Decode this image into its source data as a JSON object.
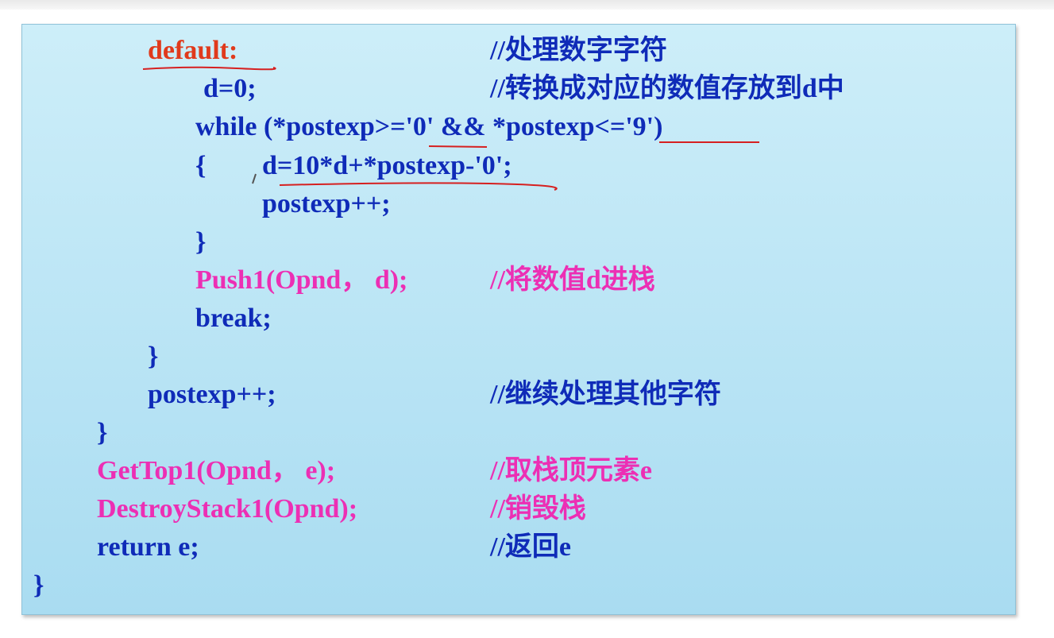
{
  "lines": {
    "default_kw": "default:",
    "c_default": "//处理数字字符",
    "d0": "d=0;",
    "c_d0": "//转换成对应的数值存放到d中",
    "while_line": "while (*postexp>='0' && *postexp<='9')",
    "brace_open": "{",
    "d_calc": "d=10*d+*postexp-'0';",
    "postexp_inc_inner": "postexp++;",
    "brace_close_inner": "}",
    "push": "Push1(Opnd， d);",
    "c_push": "//将数值d进栈",
    "break": "break;",
    "brace_close_switch": "}",
    "postexp_inc": "postexp++;",
    "c_postexp_inc": "//继续处理其他字符",
    "brace_close_while": "}",
    "gettop": "GetTop1(Opnd， e);",
    "c_gettop": "//取栈顶元素e",
    "destroy": "DestroyStack1(Opnd);",
    "c_destroy": "//销毁栈",
    "return": "return e;",
    "c_return": "//返回e",
    "brace_close_func": "}"
  },
  "colors": {
    "code": "#0f2bb8",
    "keyword_highlight": "#e03a1c",
    "function_call": "#ec2fb4",
    "annotation": "#d62020",
    "panel_bg": "#bde6f6"
  }
}
